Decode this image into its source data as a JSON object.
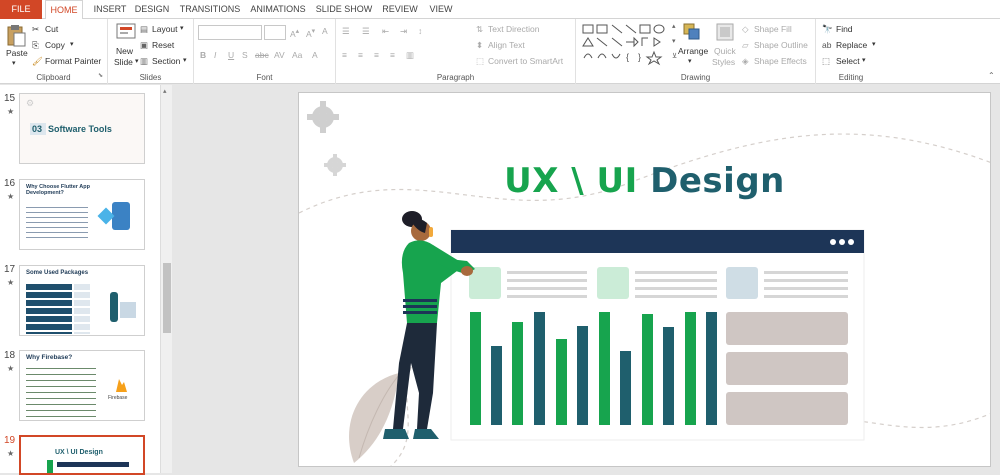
{
  "tabs": [
    "FILE",
    "HOME",
    "INSERT",
    "DESIGN",
    "TRANSITIONS",
    "ANIMATIONS",
    "SLIDE SHOW",
    "REVIEW",
    "VIEW"
  ],
  "clipboard": {
    "paste": "Paste",
    "cut": "Cut",
    "copy": "Copy",
    "format_painter": "Format Painter",
    "label": "Clipboard"
  },
  "slides_group": {
    "new_slide": "New",
    "new_slide2": "Slide",
    "layout": "Layout",
    "reset": "Reset",
    "section": "Section",
    "label": "Slides"
  },
  "font_group": {
    "label": "Font"
  },
  "paragraph_group": {
    "text_direction": "Text Direction",
    "align_text": "Align Text",
    "convert": "Convert to SmartArt",
    "label": "Paragraph"
  },
  "drawing_group": {
    "arrange": "Arrange",
    "quick": "Quick",
    "styles": "Styles",
    "shape_fill": "Shape Fill",
    "shape_outline": "Shape Outline",
    "shape_effects": "Shape Effects",
    "label": "Drawing"
  },
  "editing_group": {
    "find": "Find",
    "replace": "Replace",
    "select": "Select",
    "label": "Editing"
  },
  "thumbnails": [
    {
      "num": "15",
      "title_num": "03",
      "title": "Software Tools"
    },
    {
      "num": "16",
      "title": "Why Choose Flutter App Development?"
    },
    {
      "num": "17",
      "title": "Some Used Packages"
    },
    {
      "num": "18",
      "title": "Why Firebase?",
      "logo": "Firebase"
    },
    {
      "num": "19",
      "title": "UX \\ UI Design"
    }
  ],
  "slide": {
    "title_part1": "UX \\ UI",
    "title_part2": " Design"
  },
  "colors": {
    "accent": "#d24726",
    "green": "#17a44e",
    "teal": "#1f5f6d",
    "navy": "#1d3557"
  }
}
